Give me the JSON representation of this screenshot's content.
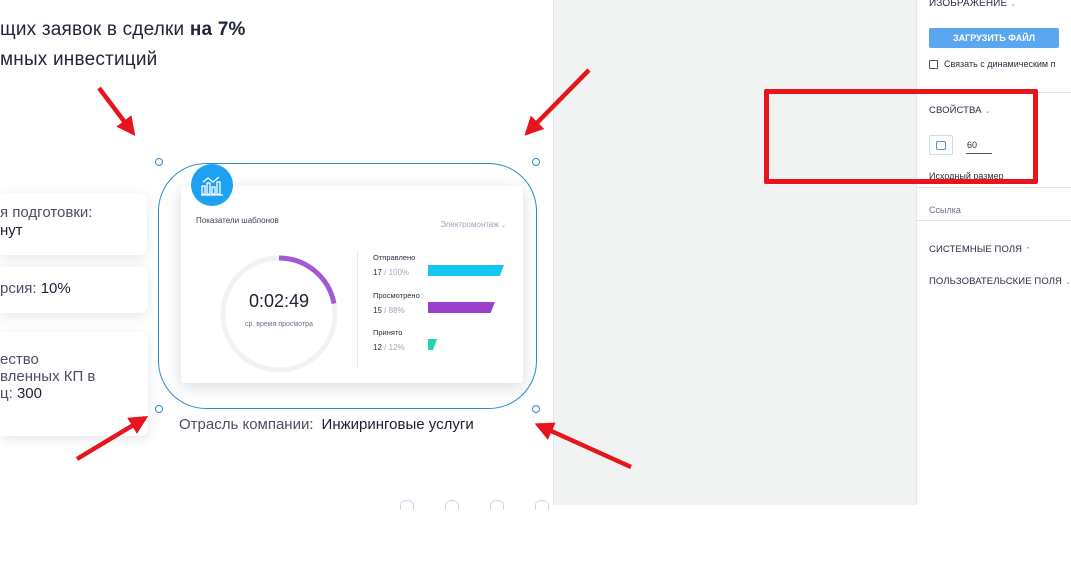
{
  "canvas": {
    "headline_pre": "щих заявок в сделки ",
    "headline_bold": "на 7%",
    "headline2": "мных инвестиций",
    "stat1_line1": "я подготовки:",
    "stat1_line2": "нут",
    "stat2_label": "рсия: ",
    "stat2_value": "10%",
    "stat3_line1": "ество",
    "stat3_line2": "вленных КП в",
    "stat3_line3_pre": "ц: ",
    "stat3_line3_val": "300",
    "industry_label": "Отрасль компании:",
    "industry_value": "Инжиринговые услуги"
  },
  "dashboard": {
    "title": "Показатели шаблонов",
    "filter": "Электромонтаж",
    "timer": "0:02:49",
    "timer_caption": "ср. время просмотра",
    "progress_fraction": 0.22,
    "metrics": [
      {
        "name": "Отправлено",
        "count": "17",
        "percent": "/ 100%",
        "fraction": 1.0,
        "color": "#15c5f2"
      },
      {
        "name": "Просмотрено",
        "count": "15",
        "percent": "/ 88%",
        "fraction": 0.88,
        "color": "#9b3fcf"
      },
      {
        "name": "Принято",
        "count": "12",
        "percent": "/ 12%",
        "fraction": 0.12,
        "color": "#22d3b4"
      }
    ]
  },
  "panel": {
    "image_section": "ИЗОБРАЖЕНИЕ",
    "upload_button": "ЗАГРУЗИТЬ ФАЙЛ",
    "dynamic_link_label": "Связать с динамическим п",
    "properties_section": "СВОЙСТВА",
    "size_value": "60",
    "original_size_label": "Исходный размер",
    "link_placeholder": "Ссылка",
    "system_fields": "СИСТЕМНЫЕ ПОЛЯ",
    "user_fields": "ПОЛЬЗОВАТЕЛЬСКИЕ ПОЛЯ"
  },
  "colors": {
    "accent": "#1da1f2",
    "selection": "#2f8fc4",
    "annotation_red": "#e8141b",
    "upload_button": "#5aa7f0",
    "donut_progress": "#a05ad6"
  }
}
